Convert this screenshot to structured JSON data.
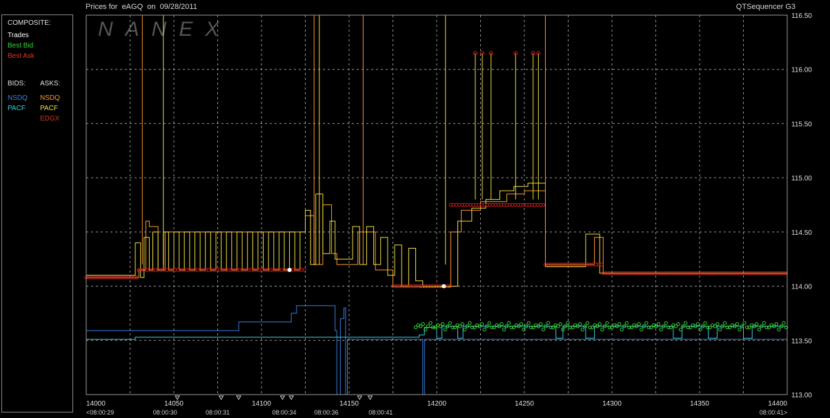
{
  "header": {
    "title": "Prices for  eAGQ  on  09/28/2011",
    "product": "QTSequencer G3"
  },
  "watermark": "NANEX",
  "legend": {
    "composite_label": "COMPOSITE:",
    "trades_label": "Trades",
    "best_bid_label": "Best Bid",
    "best_ask_label": "Best Ask",
    "bids_label": "BIDS:",
    "asks_label": "ASKS:",
    "bids": [
      {
        "name": "NSDQ",
        "color": "#3a7fe0"
      },
      {
        "name": "PACF",
        "color": "#3ad0e0"
      }
    ],
    "asks": [
      {
        "name": "NSDQ",
        "color": "#ff9a30"
      },
      {
        "name": "PACF",
        "color": "#f0e040"
      },
      {
        "name": "EDGX",
        "color": "#c83a1e"
      }
    ]
  },
  "colors": {
    "background": "#000000",
    "grid": "#9a9a9a",
    "trades": "#ffffff",
    "best_bid": "#38d838",
    "best_ask": "#d81e1e",
    "nsdq_bid": "#3a7fe0",
    "pacf_bid": "#3ad0e0",
    "nsdq_ask": "#ff9a30",
    "pacf_ask": "#f0e040"
  },
  "chart_data": {
    "type": "line",
    "xlim": [
      14000,
      14400
    ],
    "ylim": [
      113.0,
      116.5
    ],
    "x_ticks": [
      14000,
      14050,
      14100,
      14150,
      14200,
      14250,
      14300,
      14350,
      14400
    ],
    "x_tick_labels": [
      "14000",
      "14050",
      "14100",
      "14150",
      "14200",
      "14250",
      "14300",
      "14350",
      "14400"
    ],
    "y_ticks": [
      113.0,
      113.5,
      114.0,
      114.5,
      115.0,
      115.5,
      116.0,
      116.5
    ],
    "y_tick_labels": [
      "113.00",
      "113.50",
      "114.00",
      "114.50",
      "115.00",
      "115.50",
      "116.00",
      "116.50"
    ],
    "time_labels": [
      {
        "x": 14000,
        "label": "<08:00:29"
      },
      {
        "x": 14045,
        "label": "08:00:30"
      },
      {
        "x": 14075,
        "label": "08:00:31"
      },
      {
        "x": 14113,
        "label": "08:00:34"
      },
      {
        "x": 14137,
        "label": "08:00:36"
      },
      {
        "x": 14168,
        "label": "08:00:41"
      },
      {
        "x": 14400,
        "label": "08:00:41>"
      }
    ],
    "time_markers": [
      14052,
      14077,
      14087,
      14112,
      14117,
      14156,
      14162
    ],
    "series": [
      {
        "name": "NSDQ",
        "side": "bid",
        "color": "#3a7fe0",
        "points": [
          [
            14000,
            113.59
          ],
          [
            14087,
            113.59
          ],
          [
            14087,
            113.67
          ],
          [
            14117,
            113.67
          ],
          [
            14117,
            113.75
          ],
          [
            14120,
            113.75
          ],
          [
            14120,
            113.82
          ],
          [
            14142,
            113.82
          ],
          [
            14142,
            113.59
          ],
          [
            14143,
            113.59
          ],
          [
            14143,
            113.0
          ],
          [
            14145,
            113.0
          ],
          [
            14145,
            113.7
          ],
          [
            14147,
            113.7
          ],
          [
            14147,
            113.8
          ],
          [
            14148,
            113.8
          ],
          [
            14148,
            113.0
          ],
          [
            14149,
            113.0
          ],
          [
            14149,
            113.51
          ],
          [
            14192,
            113.51
          ],
          [
            14192,
            113.0
          ],
          [
            14193,
            113.0
          ],
          [
            14193,
            113.51
          ],
          [
            14400,
            113.51
          ]
        ]
      },
      {
        "name": "PACF",
        "side": "bid",
        "color": "#3ad0e0",
        "points": [
          [
            14000,
            113.51
          ],
          [
            14028,
            113.51
          ],
          [
            14028,
            113.53
          ],
          [
            14190,
            113.53
          ],
          [
            14190,
            113.55
          ],
          [
            14193,
            113.55
          ],
          [
            14193,
            113.62
          ],
          [
            14200,
            113.62
          ],
          [
            14200,
            113.52
          ],
          [
            14203,
            113.52
          ],
          [
            14203,
            113.63
          ],
          [
            14212,
            113.63
          ],
          [
            14212,
            113.52
          ],
          [
            14215,
            113.52
          ],
          [
            14215,
            113.63
          ],
          [
            14268,
            113.63
          ],
          [
            14268,
            113.52
          ],
          [
            14272,
            113.52
          ],
          [
            14272,
            113.63
          ],
          [
            14285,
            113.63
          ],
          [
            14285,
            113.52
          ],
          [
            14290,
            113.52
          ],
          [
            14290,
            113.63
          ],
          [
            14335,
            113.63
          ],
          [
            14335,
            113.52
          ],
          [
            14340,
            113.52
          ],
          [
            14340,
            113.63
          ],
          [
            14355,
            113.63
          ],
          [
            14355,
            113.52
          ],
          [
            14360,
            113.52
          ],
          [
            14360,
            113.63
          ],
          [
            14375,
            113.63
          ],
          [
            14375,
            113.52
          ],
          [
            14380,
            113.52
          ],
          [
            14380,
            113.63
          ],
          [
            14400,
            113.63
          ]
        ]
      },
      {
        "name": "NSDQ",
        "side": "ask",
        "color": "#ff9a30",
        "points": [
          [
            14000,
            114.08
          ],
          [
            14030,
            114.08
          ],
          [
            14030,
            114.15
          ],
          [
            14034,
            114.15
          ],
          [
            14034,
            114.6
          ],
          [
            14036,
            114.6
          ],
          [
            14036,
            114.55
          ],
          [
            14041,
            114.55
          ],
          [
            14041,
            114.15
          ],
          [
            14045,
            114.15
          ],
          [
            14045,
            114.5
          ],
          [
            14125,
            114.5
          ],
          [
            14125,
            114.65
          ],
          [
            14130,
            114.65
          ],
          [
            14130,
            114.2
          ],
          [
            14135,
            114.2
          ],
          [
            14135,
            114.75
          ],
          [
            14140,
            114.75
          ],
          [
            14140,
            114.3
          ],
          [
            14143,
            114.3
          ],
          [
            14143,
            114.2
          ],
          [
            14155,
            114.2
          ],
          [
            14155,
            114.5
          ],
          [
            14165,
            114.5
          ],
          [
            14165,
            114.15
          ],
          [
            14175,
            114.15
          ],
          [
            14175,
            114.0
          ],
          [
            14190,
            114.0
          ],
          [
            14190,
            113.99
          ],
          [
            14208,
            113.99
          ],
          [
            14208,
            114.5
          ],
          [
            14214,
            114.5
          ],
          [
            14214,
            114.7
          ],
          [
            14225,
            114.7
          ],
          [
            14225,
            114.78
          ],
          [
            14240,
            114.78
          ],
          [
            14240,
            114.85
          ],
          [
            14250,
            114.85
          ],
          [
            14250,
            114.88
          ],
          [
            14262,
            114.88
          ],
          [
            14262,
            114.2
          ],
          [
            14290,
            114.2
          ],
          [
            14290,
            114.45
          ],
          [
            14295,
            114.45
          ],
          [
            14295,
            114.12
          ],
          [
            14400,
            114.12
          ]
        ]
      },
      {
        "name": "PACF",
        "side": "ask",
        "color": "#f0e040",
        "points": [
          [
            14000,
            114.1
          ],
          [
            14028,
            114.1
          ],
          [
            14028,
            114.4
          ],
          [
            14031,
            114.4
          ],
          [
            14031,
            114.08
          ],
          [
            14033,
            114.08
          ],
          [
            14033,
            114.45
          ],
          [
            14036,
            114.45
          ],
          [
            14036,
            114.15
          ],
          [
            14038,
            114.15
          ],
          [
            14038,
            114.5
          ],
          [
            14041,
            114.5
          ],
          [
            14041,
            114.15
          ],
          [
            14044,
            114.15
          ],
          [
            14044,
            114.5
          ],
          [
            14047,
            114.5
          ],
          [
            14047,
            114.15
          ],
          [
            14050,
            114.15
          ],
          [
            14050,
            114.5
          ],
          [
            14053,
            114.5
          ],
          [
            14053,
            114.15
          ],
          [
            14056,
            114.15
          ],
          [
            14056,
            114.5
          ],
          [
            14059,
            114.5
          ],
          [
            14059,
            114.15
          ],
          [
            14062,
            114.15
          ],
          [
            14062,
            114.5
          ],
          [
            14065,
            114.5
          ],
          [
            14065,
            114.15
          ],
          [
            14068,
            114.15
          ],
          [
            14068,
            114.5
          ],
          [
            14071,
            114.5
          ],
          [
            14071,
            114.15
          ],
          [
            14074,
            114.15
          ],
          [
            14074,
            114.5
          ],
          [
            14077,
            114.5
          ],
          [
            14077,
            114.15
          ],
          [
            14080,
            114.15
          ],
          [
            14080,
            114.5
          ],
          [
            14083,
            114.5
          ],
          [
            14083,
            114.15
          ],
          [
            14086,
            114.15
          ],
          [
            14086,
            114.5
          ],
          [
            14089,
            114.5
          ],
          [
            14089,
            114.15
          ],
          [
            14092,
            114.15
          ],
          [
            14092,
            114.5
          ],
          [
            14095,
            114.5
          ],
          [
            14095,
            114.15
          ],
          [
            14098,
            114.15
          ],
          [
            14098,
            114.5
          ],
          [
            14101,
            114.5
          ],
          [
            14101,
            114.15
          ],
          [
            14104,
            114.15
          ],
          [
            14104,
            114.5
          ],
          [
            14107,
            114.5
          ],
          [
            14107,
            114.15
          ],
          [
            14110,
            114.15
          ],
          [
            14110,
            114.5
          ],
          [
            14113,
            114.5
          ],
          [
            14113,
            114.15
          ],
          [
            14116,
            114.15
          ],
          [
            14116,
            114.5
          ],
          [
            14119,
            114.5
          ],
          [
            14119,
            114.15
          ],
          [
            14122,
            114.15
          ],
          [
            14122,
            114.5
          ],
          [
            14125,
            114.5
          ],
          [
            14125,
            114.7
          ],
          [
            14128,
            114.7
          ],
          [
            14128,
            114.2
          ],
          [
            14131,
            114.2
          ],
          [
            14131,
            114.85
          ],
          [
            14135,
            114.85
          ],
          [
            14135,
            114.3
          ],
          [
            14139,
            114.3
          ],
          [
            14139,
            114.6
          ],
          [
            14142,
            114.6
          ],
          [
            14142,
            114.25
          ],
          [
            14152,
            114.25
          ],
          [
            14152,
            114.55
          ],
          [
            14156,
            114.55
          ],
          [
            14156,
            114.2
          ],
          [
            14160,
            114.2
          ],
          [
            14160,
            114.55
          ],
          [
            14164,
            114.55
          ],
          [
            14164,
            114.2
          ],
          [
            14168,
            114.2
          ],
          [
            14168,
            114.45
          ],
          [
            14172,
            114.45
          ],
          [
            14172,
            114.1
          ],
          [
            14176,
            114.1
          ],
          [
            14176,
            114.38
          ],
          [
            14180,
            114.38
          ],
          [
            14180,
            114.0
          ],
          [
            14184,
            114.0
          ],
          [
            14184,
            114.35
          ],
          [
            14188,
            114.35
          ],
          [
            14188,
            114.05
          ],
          [
            14192,
            114.05
          ],
          [
            14192,
            114.0
          ],
          [
            14212,
            114.0
          ],
          [
            14212,
            114.6
          ],
          [
            14220,
            114.6
          ],
          [
            14220,
            114.72
          ],
          [
            14228,
            114.72
          ],
          [
            14228,
            114.8
          ],
          [
            14236,
            114.8
          ],
          [
            14236,
            114.88
          ],
          [
            14244,
            114.88
          ],
          [
            14244,
            114.92
          ],
          [
            14252,
            114.92
          ],
          [
            14252,
            114.95
          ],
          [
            14262,
            114.95
          ],
          [
            14262,
            114.18
          ],
          [
            14285,
            114.18
          ],
          [
            14285,
            114.48
          ],
          [
            14293,
            114.48
          ],
          [
            14293,
            114.12
          ],
          [
            14400,
            114.12
          ]
        ]
      }
    ],
    "best_bid_markers": {
      "x_range": [
        14188,
        14400
      ],
      "y_values": [
        113.62,
        113.64,
        113.63,
        113.65,
        113.6,
        113.63,
        113.66,
        113.62
      ]
    },
    "best_ask_markers": {
      "segments": [
        {
          "x": [
            14000,
            14030
          ],
          "y": 114.08
        },
        {
          "x": [
            14030,
            14125
          ],
          "y": 114.15
        },
        {
          "x": [
            14175,
            14208
          ],
          "y": 114.0
        },
        {
          "x": [
            14208,
            14262
          ],
          "y": 114.75
        },
        {
          "x": [
            14262,
            14295
          ],
          "y": 114.2
        },
        {
          "x": [
            14295,
            14400
          ],
          "y": 114.12
        }
      ]
    },
    "trades": [
      {
        "x": 14116,
        "y": 114.15
      },
      {
        "x": 14204,
        "y": 114.0
      }
    ]
  }
}
